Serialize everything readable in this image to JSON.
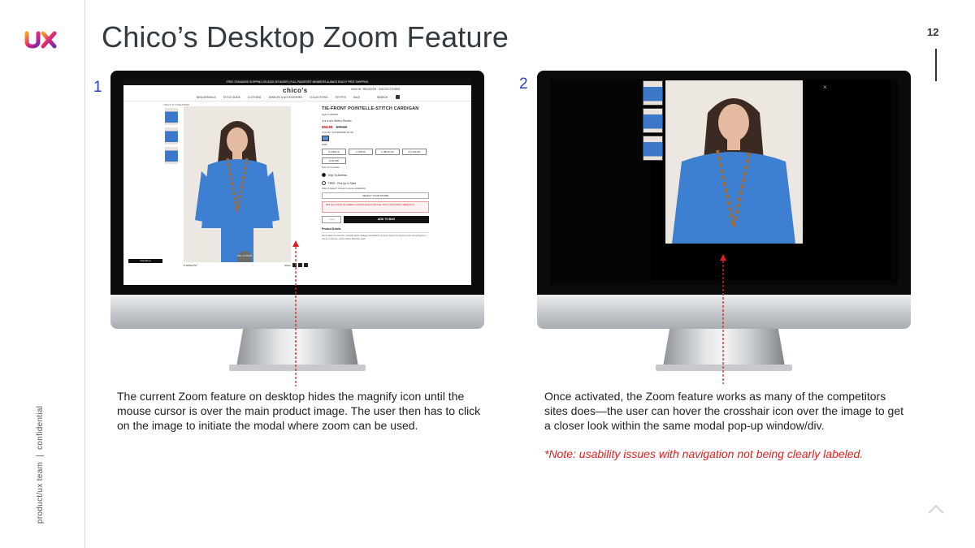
{
  "slide": {
    "title": "Chico’s Desktop Zoom Feature",
    "page_number": "12",
    "footer_left": "product/ux team",
    "footer_sep": "|",
    "footer_right": "confidential",
    "logo_text": "ux"
  },
  "colors": {
    "accent_blue": "#2b3fc6",
    "note_red": "#e02020",
    "pointer_red": "#e02020"
  },
  "panels": [
    {
      "number": "1",
      "caption": "The current Zoom feature on desktop hides the magnify icon until the mouse cursor is over the main product image. The user then has to click on the image to initiate the modal where zoom can be used."
    },
    {
      "number": "2",
      "caption": "Once activated, the Zoom feature works as many of the competitors sites does—the user can hover the crosshair icon over the image to get a closer look within the same modal pop-up window/div.",
      "note": "*Note: usability issues with navigation not being clearly labeled."
    }
  ],
  "site": {
    "promo": "FREE STANDARD SHIPPING ON $125 OR MORE! | FULL PASSPORT MEMBERS ALWAYS ENJOY FREE SHIPPING",
    "brand": "chico's",
    "utility": "SIGN IN · REGISTER · CHICOS STORES",
    "nav": [
      "NEW ARRIVALS",
      "STYLE GUIDE",
      "CLOTHING",
      "JEWELRY & ACCESSORIES",
      "COLLECTIONS",
      "PETITES",
      "SALE"
    ],
    "search_label": "SEARCH",
    "breadcrumb": "< BACK TO SWEATERS",
    "zoom_hint": "ROLL TO ZOOM",
    "product_title": "TIE-FRONT POINTELLE-STITCH CARDIGAN",
    "product_sub": "Style # 000000",
    "rating": "★★★★★ Write a Review",
    "sale_price": "$54.99",
    "orig_price": "$79.50",
    "color_label": "COLOR: SHOREBIRD BLUE",
    "size_label": "SIZE",
    "sizes": [
      "0 (XS/2-4)",
      "1 (S/6-8)",
      "2 (M/10-12)",
      "3 (L/14-16)",
      "4 (XL/18)"
    ],
    "fit_guide": "Size & Fit Guide",
    "ship_option": "Ship To Address",
    "pickup_option": "FREE - Pick Up In Store",
    "store_question": "Want it faster? Check in-store availability",
    "select_store": "SELECT YOUR STORE",
    "alert": "Pick Up In Store is available in limited areas at this time. More stores will be added soon.",
    "qty": "– 1 +",
    "add_to_bag": "ADD TO BAG",
    "details_label": "Product Details",
    "details_text": "We've taken our favorite, pointelle-stitch cardigan and added a tie front. Perfect for layering over everything from camis to dresses. Cotton blend. Machine wash.",
    "wishlist": "♥ WISHLIST",
    "share_label": "Share",
    "chat": "Chat with us"
  }
}
